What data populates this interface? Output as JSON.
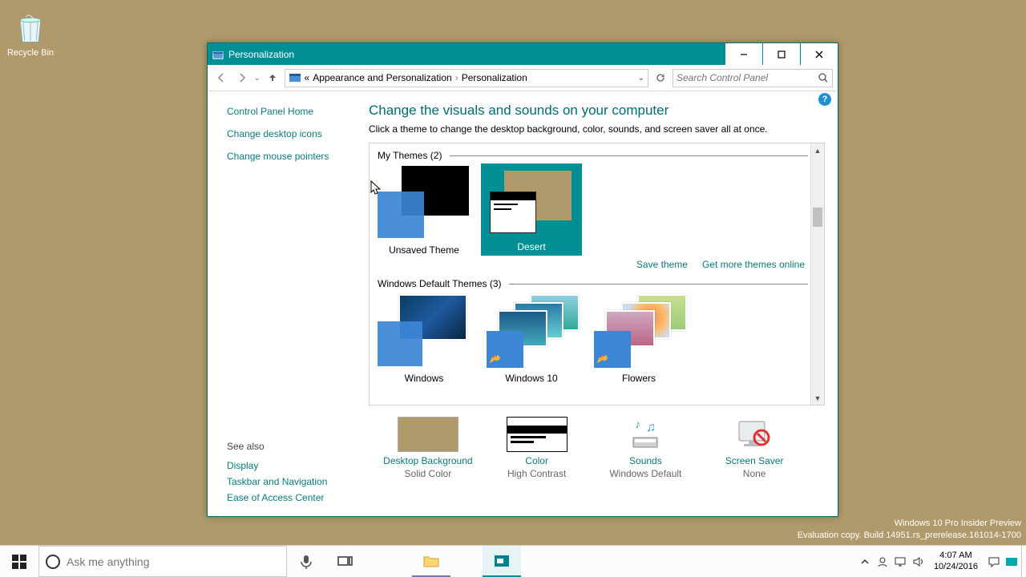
{
  "desktop": {
    "recycle": "Recycle Bin"
  },
  "window": {
    "title": "Personalization",
    "breadcrumb": {
      "pre": "«",
      "p1": "Appearance and Personalization",
      "p2": "Personalization"
    },
    "search_placeholder": "Search Control Panel"
  },
  "sidebar": {
    "home": "Control Panel Home",
    "l1": "Change desktop icons",
    "l2": "Change mouse pointers",
    "seealso": "See also",
    "s1": "Display",
    "s2": "Taskbar and Navigation",
    "s3": "Ease of Access Center"
  },
  "main": {
    "heading": "Change the visuals and sounds on your computer",
    "sub": "Click a theme to change the desktop background, color, sounds, and screen saver all at once.",
    "my_themes": "My Themes (2)",
    "t1": "Unsaved Theme",
    "t2": "Desert",
    "save": "Save theme",
    "more": "Get more themes online",
    "default_themes": "Windows Default Themes (3)",
    "d1": "Windows",
    "d2": "Windows 10",
    "d3": "Flowers"
  },
  "bottom": {
    "b1": "Desktop Background",
    "b1v": "Solid Color",
    "b2": "Color",
    "b2v": "High Contrast",
    "b3": "Sounds",
    "b3v": "Windows Default",
    "b4": "Screen Saver",
    "b4v": "None"
  },
  "overlay": {
    "l1": "Windows 10 Pro Insider Preview",
    "l2": "Evaluation copy. Build 14951.rs_prerelease.161014-1700"
  },
  "taskbar": {
    "cortana": "Ask me anything",
    "time": "4:07 AM",
    "date": "10/24/2016"
  }
}
